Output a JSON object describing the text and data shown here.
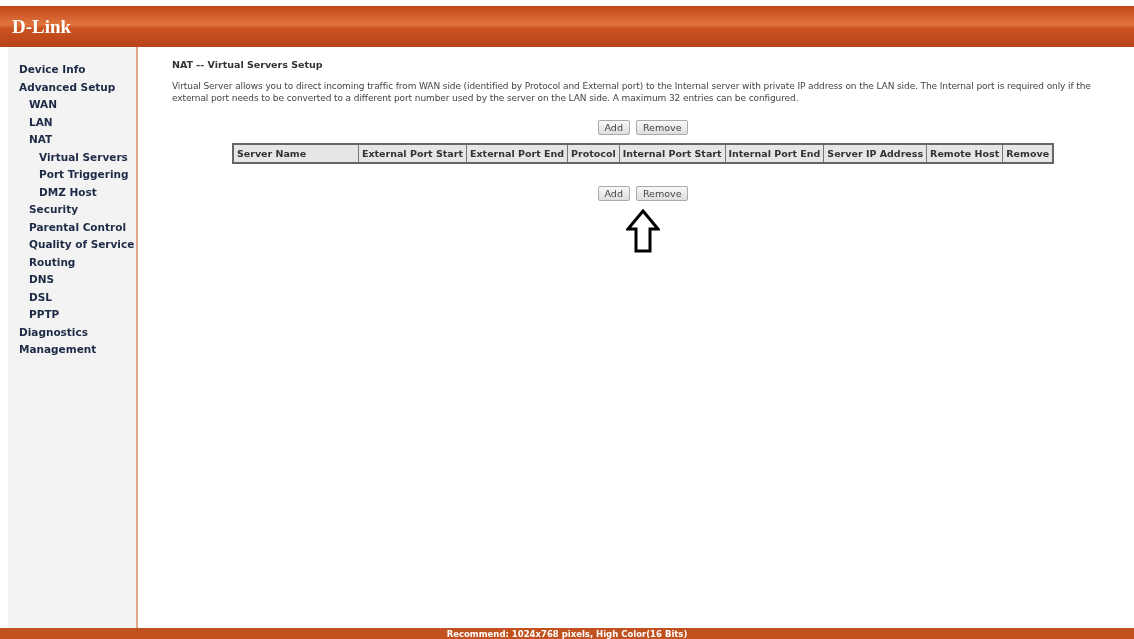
{
  "header": {
    "logo": "D-Link"
  },
  "sidebar": {
    "items": [
      {
        "label": "Device Info"
      },
      {
        "label": "Advanced Setup",
        "children": [
          {
            "label": "WAN"
          },
          {
            "label": "LAN"
          },
          {
            "label": "NAT",
            "children": [
              {
                "label": "Virtual Servers"
              },
              {
                "label": "Port Triggering"
              },
              {
                "label": "DMZ Host"
              }
            ]
          },
          {
            "label": "Security"
          },
          {
            "label": "Parental Control"
          },
          {
            "label": "Quality of Service"
          },
          {
            "label": "Routing"
          },
          {
            "label": "DNS"
          },
          {
            "label": "DSL"
          },
          {
            "label": "PPTP"
          }
        ]
      },
      {
        "label": "Diagnostics"
      },
      {
        "label": "Management"
      }
    ]
  },
  "content": {
    "title": "NAT -- Virtual Servers Setup",
    "description": "Virtual Server allows you to direct incoming traffic from WAN side (identified by Protocol and External port) to the Internal server with private IP address on the LAN side. The Internal port is required only if the external port needs to be converted to a different port number used by the server on the LAN side. A maximum 32 entries can be configured.",
    "top_buttons": [
      "Add",
      "Remove"
    ],
    "table": {
      "columns": [
        "Server Name",
        "External Port Start",
        "External Port End",
        "Protocol",
        "Internal Port Start",
        "Internal Port End",
        "Server IP Address",
        "Remote Host",
        "Remove"
      ]
    },
    "bottom_buttons": [
      "Add",
      "Remove"
    ]
  },
  "footer": {
    "text": "Recommend: 1024x768 pixels, High Color(16 Bits)"
  }
}
